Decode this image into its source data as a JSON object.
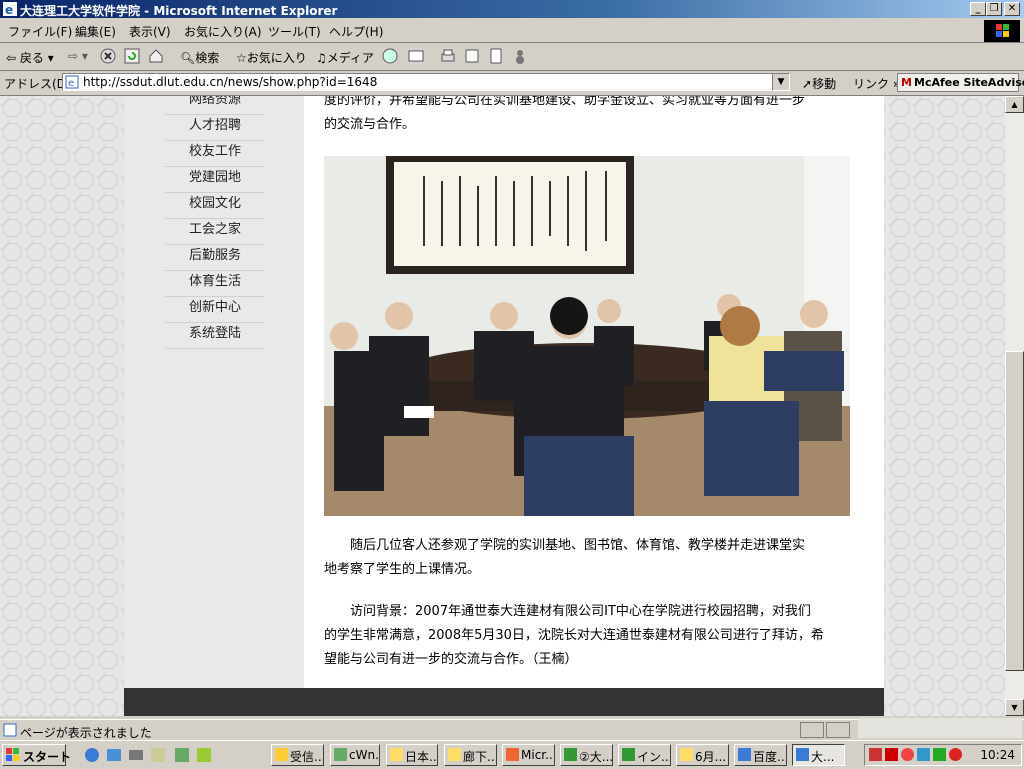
{
  "window": {
    "title": "大连理工大学软件学院 - Microsoft Internet Explorer"
  },
  "menu": {
    "items": [
      "ファイル(F)",
      "編集(E)",
      "表示(V)",
      "お気に入り(A)",
      "ツール(T)",
      "ヘルプ(H)"
    ]
  },
  "toolbar": {
    "back": "戻る",
    "search": "検索",
    "favorites": "お気に入り",
    "media": "メディア"
  },
  "address": {
    "label": "アドレス(D)",
    "url": "http://ssdut.dlut.edu.cn/news/show.php?id=1648",
    "go": "移動",
    "links": "リンク",
    "siteadvisor": "McAfee SiteAdvisor"
  },
  "sidebar": {
    "items": [
      "网络资源",
      "人才招聘",
      "校友工作",
      "党建园地",
      "校园文化",
      "工会之家",
      "后勤服务",
      "体育生活",
      "创新中心",
      "系统登陆"
    ]
  },
  "article": {
    "top_line1": "度的评价，并希望能与公司在实训基地建设、助学金设立、实习就业等方面有进一步",
    "top_line2": "的交流与合作。",
    "p2_line1": "随后几位客人还参观了学院的实训基地、图书馆、体育馆、教学楼并走进课堂实",
    "p2_line2": "地考察了学生的上课情况。",
    "p3_line1": "访问背景：2007年通世泰大连建材有限公司IT中心在学院进行校园招聘，对我们",
    "p3_line2": "的学生非常满意，2008年5月30日，沈院长对大连通世泰建材有限公司进行了拜访，希",
    "p3_line3": "望能与公司有进一步的交流与合作。（王楠）"
  },
  "status": {
    "text": "ページが表示されました"
  },
  "taskbar": {
    "start": "スタート",
    "tasks": [
      "受信...",
      "cWn...",
      "日本...",
      "廊下...",
      "Micr...",
      "②大...",
      "イン...",
      "6月...",
      "百度...",
      "大..."
    ],
    "clock": "10:24"
  },
  "colors": {
    "titlebar": "#0a246a",
    "chrome": "#d4d0c8",
    "sidebar_bg": "#e9e9e9",
    "footer": "#333333"
  }
}
